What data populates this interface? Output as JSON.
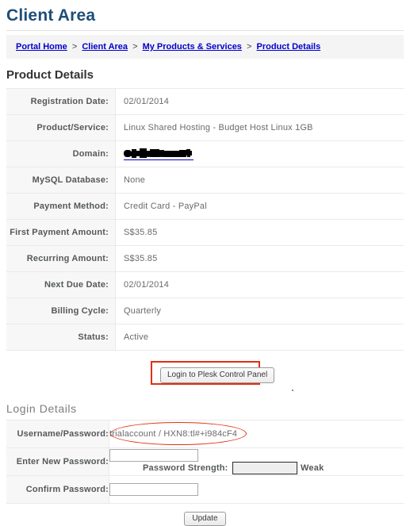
{
  "page": {
    "title": "Client Area"
  },
  "breadcrumb": {
    "separator": ">",
    "items": [
      {
        "label": "Portal Home"
      },
      {
        "label": "Client Area"
      },
      {
        "label": "My Products & Services"
      },
      {
        "label": "Product Details"
      }
    ]
  },
  "product_details": {
    "heading": "Product Details",
    "rows": [
      {
        "label": "Registration Date:",
        "value": "02/01/2014"
      },
      {
        "label": "Product/Service:",
        "value": "Linux Shared Hosting - Budget Host Linux 1GB"
      },
      {
        "label": "Domain:",
        "value": ""
      },
      {
        "label": "MySQL Database:",
        "value": "None"
      },
      {
        "label": "Payment Method:",
        "value": "Credit Card - PayPal"
      },
      {
        "label": "First Payment Amount:",
        "value": "S$35.85"
      },
      {
        "label": "Recurring Amount:",
        "value": "S$35.85"
      },
      {
        "label": "Next Due Date:",
        "value": "02/01/2014"
      },
      {
        "label": "Billing Cycle:",
        "value": "Quarterly"
      },
      {
        "label": "Status:",
        "value": "Active"
      }
    ]
  },
  "plesk": {
    "button_label": "Login to Plesk Control Panel"
  },
  "login_details": {
    "heading": "Login Details",
    "credentials_label": "Username/Password:",
    "credentials_value": "trialaccount / HXN8:tl#+i984cF4",
    "new_password_label": "Enter New Password:",
    "new_password_value": "",
    "new_password_placeholder": "",
    "confirm_password_label": "Confirm Password:",
    "confirm_password_value": "",
    "confirm_password_placeholder": "",
    "strength_label": "Password Strength:",
    "strength_word": "Weak",
    "update_label": "Update"
  },
  "colors": {
    "title_blue": "#1f4e79",
    "link_blue": "#0000cc",
    "annotation_red": "#e03010",
    "label_background": "#f7f7f7",
    "breadcrumb_background": "#f4f4f4"
  }
}
